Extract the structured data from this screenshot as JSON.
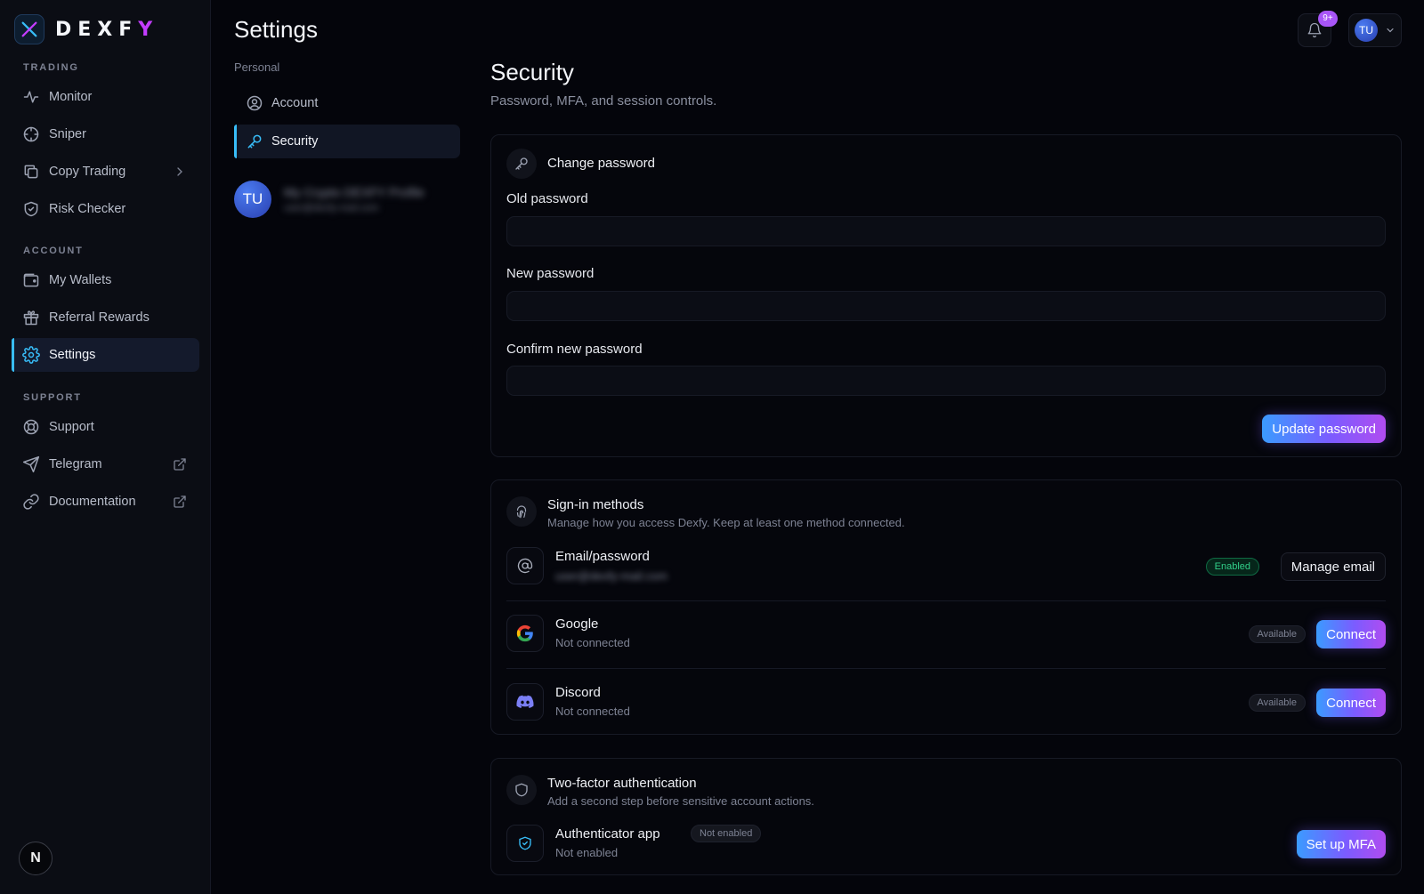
{
  "brand": {
    "name_prefix": "DEXF",
    "name_suffix": "Y"
  },
  "sidebar": {
    "groups": [
      {
        "heading": "TRADING",
        "items": [
          {
            "label": "Monitor",
            "icon": "activity-icon"
          },
          {
            "label": "Sniper",
            "icon": "crosshair-icon"
          },
          {
            "label": "Copy Trading",
            "icon": "copy-icon",
            "has_submenu": true
          },
          {
            "label": "Risk Checker",
            "icon": "shield-check-icon"
          }
        ]
      },
      {
        "heading": "ACCOUNT",
        "items": [
          {
            "label": "My Wallets",
            "icon": "wallet-icon"
          },
          {
            "label": "Referral Rewards",
            "icon": "gift-icon"
          },
          {
            "label": "Settings",
            "icon": "gear-icon",
            "active": true
          }
        ]
      },
      {
        "heading": "SUPPORT",
        "items": [
          {
            "label": "Support",
            "icon": "life-buoy-icon"
          },
          {
            "label": "Telegram",
            "icon": "send-icon",
            "external": true
          },
          {
            "label": "Documentation",
            "icon": "link-icon",
            "external": true
          }
        ]
      }
    ],
    "bottom_badge": "N"
  },
  "settings_nav": {
    "title": "Settings",
    "section_label": "Personal",
    "items": [
      {
        "label": "Account",
        "icon": "user-circle-icon"
      },
      {
        "label": "Security",
        "icon": "key-icon",
        "active": true
      }
    ],
    "profile": {
      "initials": "TU",
      "name": "My Crypto DEXFY Profile",
      "email": "user@dexfy-mail.com"
    }
  },
  "header": {
    "notification_count": "9+",
    "user_initials": "TU"
  },
  "security": {
    "title": "Security",
    "subtitle": "Password, MFA, and session controls.",
    "change_password": {
      "title": "Change password",
      "fields": [
        {
          "label": "Old password",
          "value": ""
        },
        {
          "label": "New password",
          "value": ""
        },
        {
          "label": "Confirm new password",
          "value": ""
        }
      ],
      "submit_label": "Update password"
    },
    "sign_in_methods": {
      "title": "Sign-in methods",
      "description": "Manage how you access Dexfy. Keep at least one method connected.",
      "methods": [
        {
          "name": "Email/password",
          "detail": "user@dexfy-mail.com",
          "status": "Enabled",
          "action": "Manage email"
        },
        {
          "name": "Google",
          "detail": "Not connected",
          "status": "Available",
          "action": "Connect"
        },
        {
          "name": "Discord",
          "detail": "Not connected",
          "status": "Available",
          "action": "Connect"
        }
      ]
    },
    "two_factor": {
      "title": "Two-factor authentication",
      "description": "Add a second step before sensitive account actions.",
      "method": {
        "name": "Authenticator app",
        "badge": "Not enabled",
        "detail": "Not enabled",
        "action": "Set up MFA"
      }
    }
  },
  "colors": {
    "accent": "#38bdf8",
    "brand_purple": "#c33cff",
    "badge_purple": "#a855f7",
    "enabled_green": "#31d08a"
  }
}
